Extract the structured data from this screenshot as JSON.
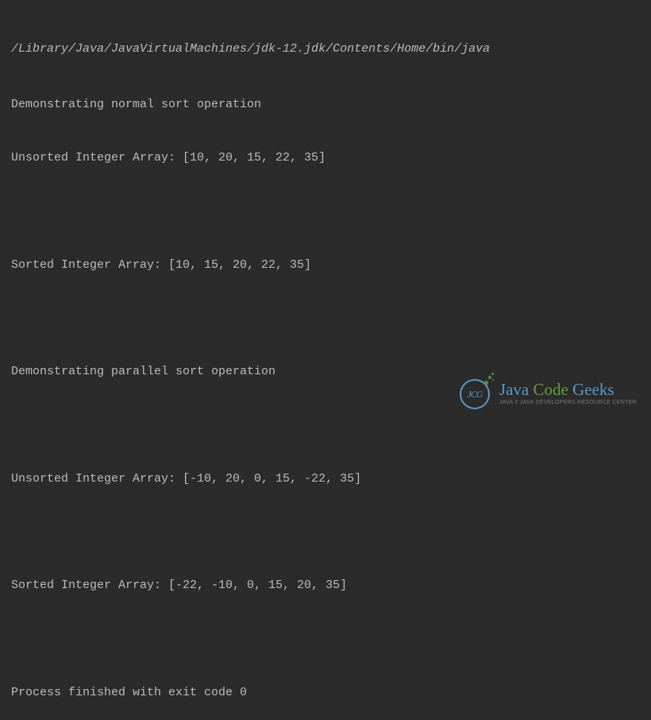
{
  "console": {
    "path": "/Library/Java/JavaVirtualMachines/jdk-12.jdk/Contents/Home/bin/java",
    "lines": [
      "Demonstrating normal sort operation",
      "Unsorted Integer Array: [10, 20, 15, 22, 35]",
      "",
      "Sorted Integer Array: [10, 15, 20, 22, 35]",
      "",
      "Demonstrating parallel sort operation",
      "",
      "Unsorted Integer Array: [-10, 20, 0, 15, -22, 35]",
      "",
      "Sorted Integer Array: [-22, -10, 0, 15, 20, 35]",
      "",
      "Process finished with exit code 0"
    ]
  },
  "watermark": {
    "logo_inner": "JCG",
    "title_java": "Java ",
    "title_code": "Code ",
    "title_geeks": "Geeks",
    "subtitle": "Java 2 Java Developers Resource Center"
  }
}
